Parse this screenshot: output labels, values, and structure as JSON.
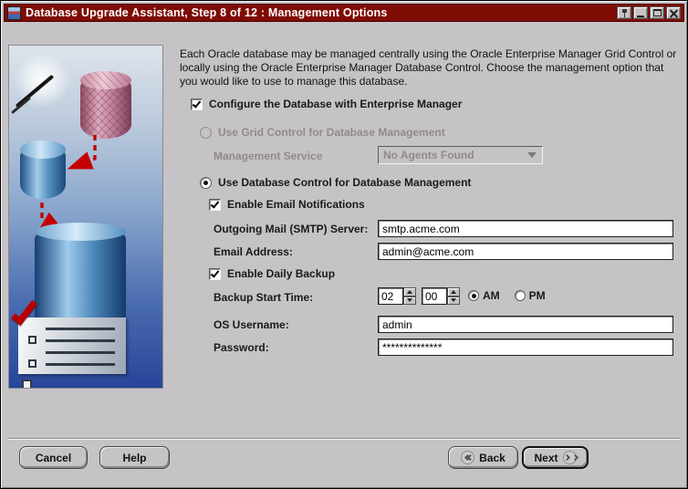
{
  "window": {
    "title": "Database Upgrade Assistant, Step 8 of 12 : Management Options"
  },
  "intro": "Each Oracle database may be managed centrally using the Oracle Enterprise Manager Grid Control or locally using the Oracle Enterprise Manager Database Control. Choose the management option that you would like to use to manage this database.",
  "form": {
    "configure_em": {
      "label": "Configure the Database with Enterprise Manager",
      "checked": true
    },
    "grid_control": {
      "label": "Use Grid Control for Database Management",
      "selected": false,
      "disabled": true
    },
    "management_service": {
      "label": "Management Service",
      "value": "No Agents Found",
      "disabled": true
    },
    "db_control": {
      "label": "Use Database Control for Database Management",
      "selected": true
    },
    "email_notifications": {
      "label": "Enable Email Notifications",
      "checked": true
    },
    "smtp_server": {
      "label": "Outgoing Mail (SMTP) Server:",
      "value": "smtp.acme.com"
    },
    "email_address": {
      "label": "Email Address:",
      "value": "admin@acme.com"
    },
    "daily_backup": {
      "label": "Enable Daily Backup",
      "checked": true
    },
    "backup_time": {
      "label": "Backup Start Time:",
      "hour": "02",
      "minute": "00",
      "am": "AM",
      "pm": "PM",
      "meridiem_selected": "AM"
    },
    "os_username": {
      "label": "OS Username:",
      "value": "admin"
    },
    "password": {
      "label": "Password:",
      "value": "**************"
    }
  },
  "buttons": {
    "cancel": "Cancel",
    "help": "Help",
    "back": "Back",
    "next": "Next"
  },
  "colors": {
    "titlebar": "#7e0c04",
    "background": "#c6c3c6",
    "accent_red": "#b80000"
  }
}
